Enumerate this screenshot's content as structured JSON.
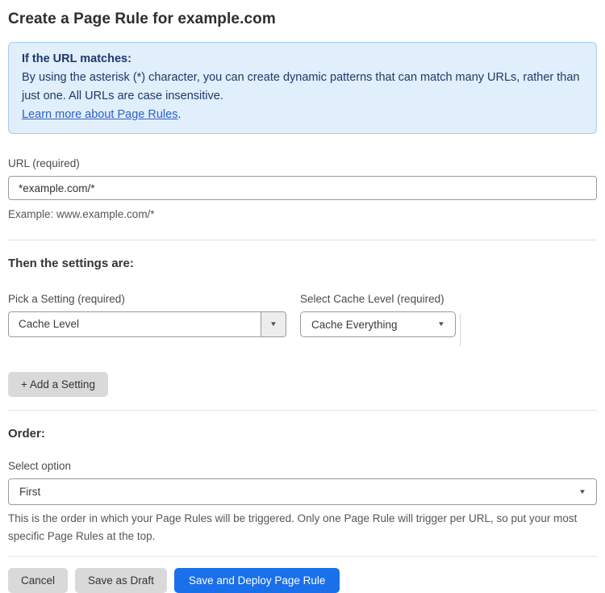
{
  "page": {
    "title": "Create a Page Rule for example.com"
  },
  "info_box": {
    "heading": "If the URL matches:",
    "body": "By using the asterisk (*) character, you can create dynamic patterns that can match many URLs, rather than just one. All URLs are case insensitive.",
    "link_label": "Learn more about Page Rules",
    "link_suffix": "."
  },
  "url_field": {
    "label": "URL (required)",
    "value": "*example.com/*",
    "helper": "Example: www.example.com/*"
  },
  "settings_section": {
    "heading": "Then the settings are:",
    "setting_picker": {
      "label": "Pick a Setting (required)",
      "selected": "Cache Level"
    },
    "cache_level_picker": {
      "label": "Select Cache Level (required)",
      "selected": "Cache Everything"
    },
    "add_setting_label": "+ Add a Setting"
  },
  "order_section": {
    "heading": "Order:",
    "select_label": "Select option",
    "selected": "First",
    "helper": "This is the order in which your Page Rules will be triggered. Only one Page Rule will trigger per URL, so put your most specific Page Rules at the top."
  },
  "actions": {
    "cancel_label": "Cancel",
    "save_draft_label": "Save as Draft",
    "save_deploy_label": "Save and Deploy Page Rule"
  },
  "icons": {
    "dropdown_arrow": "▼"
  },
  "colors": {
    "info_bg": "#e1eefb",
    "info_border": "#a9cdf0",
    "info_text": "#1e3a68",
    "link_blue": "#2d62c4",
    "primary_button_blue": "#1a70ea",
    "gray_button": "#d9d9d9"
  }
}
